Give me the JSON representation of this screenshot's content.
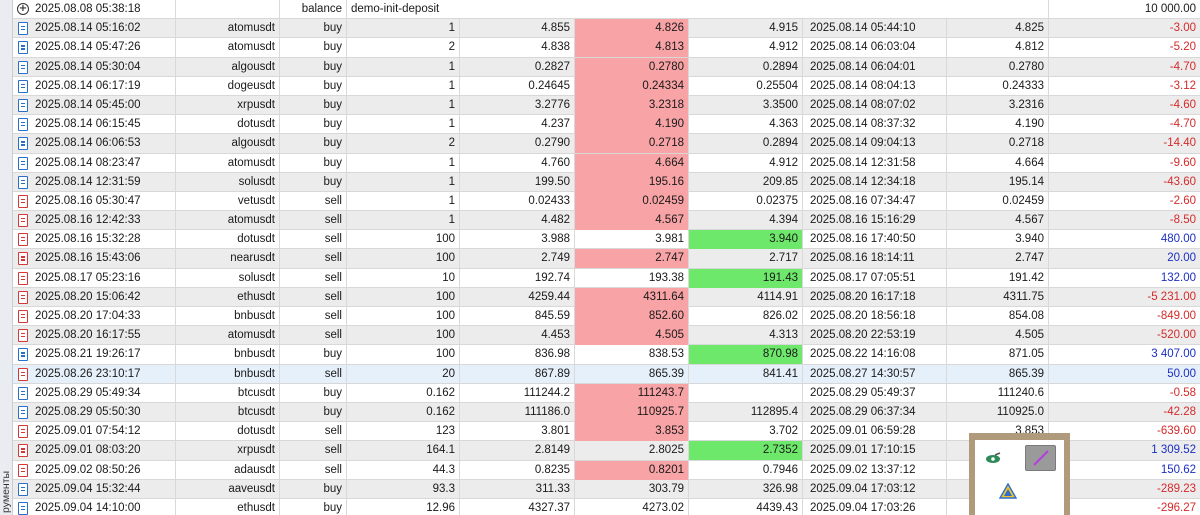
{
  "sidebar": {
    "label": "рументы"
  },
  "colors": {
    "row_alt": "#ececec",
    "row_plain": "#ffffff",
    "row_selected": "#e6f0fa",
    "loss_highlight": "#f8a3a6",
    "profit_highlight": "#6ee86a",
    "negative_text": "#d42a2a",
    "positive_text": "#1b2fc2",
    "buy_icon": "#2a6fc9",
    "sell_icon": "#d43838"
  },
  "balance_row": {
    "icon": "plus-circle-icon",
    "time": "2025.08.08 05:38:18",
    "type": "balance",
    "comment": "demo-init-deposit",
    "profit": "10 000.00"
  },
  "rows": [
    {
      "time": "2025.08.14 05:16:02",
      "symbol": "atomusdt",
      "type": "buy",
      "volume": "1",
      "open": "4.855",
      "sl": "4.826",
      "tp": "4.915",
      "close_time": "2025.08.14 05:44:10",
      "close_price": "4.825",
      "profit": "-3.00",
      "sl_hl": true,
      "tp_hl": false,
      "sign": "neg"
    },
    {
      "time": "2025.08.14 05:47:26",
      "symbol": "atomusdt",
      "type": "buy",
      "volume": "2",
      "open": "4.838",
      "sl": "4.813",
      "tp": "4.912",
      "close_time": "2025.08.14 06:03:04",
      "close_price": "4.812",
      "profit": "-5.20",
      "sl_hl": true,
      "tp_hl": false,
      "sign": "neg"
    },
    {
      "time": "2025.08.14 05:30:04",
      "symbol": "algousdt",
      "type": "buy",
      "volume": "1",
      "open": "0.2827",
      "sl": "0.2780",
      "tp": "0.2894",
      "close_time": "2025.08.14 06:04:01",
      "close_price": "0.2780",
      "profit": "-4.70",
      "sl_hl": true,
      "tp_hl": false,
      "sign": "neg"
    },
    {
      "time": "2025.08.14 06:17:19",
      "symbol": "dogeusdt",
      "type": "buy",
      "volume": "1",
      "open": "0.24645",
      "sl": "0.24334",
      "tp": "0.25504",
      "close_time": "2025.08.14 08:04:13",
      "close_price": "0.24333",
      "profit": "-3.12",
      "sl_hl": true,
      "tp_hl": false,
      "sign": "neg"
    },
    {
      "time": "2025.08.14 05:45:00",
      "symbol": "xrpusdt",
      "type": "buy",
      "volume": "1",
      "open": "3.2776",
      "sl": "3.2318",
      "tp": "3.3500",
      "close_time": "2025.08.14 08:07:02",
      "close_price": "3.2316",
      "profit": "-4.60",
      "sl_hl": true,
      "tp_hl": false,
      "sign": "neg"
    },
    {
      "time": "2025.08.14 06:15:45",
      "symbol": "dotusdt",
      "type": "buy",
      "volume": "1",
      "open": "4.237",
      "sl": "4.190",
      "tp": "4.363",
      "close_time": "2025.08.14 08:37:32",
      "close_price": "4.190",
      "profit": "-4.70",
      "sl_hl": true,
      "tp_hl": false,
      "sign": "neg"
    },
    {
      "time": "2025.08.14 06:06:53",
      "symbol": "algousdt",
      "type": "buy",
      "volume": "2",
      "open": "0.2790",
      "sl": "0.2718",
      "tp": "0.2894",
      "close_time": "2025.08.14 09:04:13",
      "close_price": "0.2718",
      "profit": "-14.40",
      "sl_hl": true,
      "tp_hl": false,
      "sign": "neg"
    },
    {
      "time": "2025.08.14 08:23:47",
      "symbol": "atomusdt",
      "type": "buy",
      "volume": "1",
      "open": "4.760",
      "sl": "4.664",
      "tp": "4.912",
      "close_time": "2025.08.14 12:31:58",
      "close_price": "4.664",
      "profit": "-9.60",
      "sl_hl": true,
      "tp_hl": false,
      "sign": "neg"
    },
    {
      "time": "2025.08.14 12:31:59",
      "symbol": "solusdt",
      "type": "buy",
      "volume": "1",
      "open": "199.50",
      "sl": "195.16",
      "tp": "209.85",
      "close_time": "2025.08.14 12:34:18",
      "close_price": "195.14",
      "profit": "-43.60",
      "sl_hl": true,
      "tp_hl": false,
      "sign": "neg"
    },
    {
      "time": "2025.08.16 05:30:47",
      "symbol": "vetusdt",
      "type": "sell",
      "volume": "1",
      "open": "0.02433",
      "sl": "0.02459",
      "tp": "0.02375",
      "close_time": "2025.08.16 07:34:47",
      "close_price": "0.02459",
      "profit": "-2.60",
      "sl_hl": true,
      "tp_hl": false,
      "sign": "neg"
    },
    {
      "time": "2025.08.16 12:42:33",
      "symbol": "atomusdt",
      "type": "sell",
      "volume": "1",
      "open": "4.482",
      "sl": "4.567",
      "tp": "4.394",
      "close_time": "2025.08.16 15:16:29",
      "close_price": "4.567",
      "profit": "-8.50",
      "sl_hl": true,
      "tp_hl": false,
      "sign": "neg"
    },
    {
      "time": "2025.08.16 15:32:28",
      "symbol": "dotusdt",
      "type": "sell",
      "volume": "100",
      "open": "3.988",
      "sl": "3.981",
      "tp": "3.940",
      "close_time": "2025.08.16 17:40:50",
      "close_price": "3.940",
      "profit": "480.00",
      "sl_hl": false,
      "tp_hl": true,
      "sign": "pos"
    },
    {
      "time": "2025.08.16 15:43:06",
      "symbol": "nearusdt",
      "type": "sell",
      "volume": "100",
      "open": "2.749",
      "sl": "2.747",
      "tp": "2.717",
      "close_time": "2025.08.16 18:14:11",
      "close_price": "2.747",
      "profit": "20.00",
      "sl_hl": true,
      "tp_hl": false,
      "sign": "pos"
    },
    {
      "time": "2025.08.17 05:23:16",
      "symbol": "solusdt",
      "type": "sell",
      "volume": "10",
      "open": "192.74",
      "sl": "193.38",
      "tp": "191.43",
      "close_time": "2025.08.17 07:05:51",
      "close_price": "191.42",
      "profit": "132.00",
      "sl_hl": false,
      "tp_hl": true,
      "sign": "pos"
    },
    {
      "time": "2025.08.20 15:06:42",
      "symbol": "ethusdt",
      "type": "sell",
      "volume": "100",
      "open": "4259.44",
      "sl": "4311.64",
      "tp": "4114.91",
      "close_time": "2025.08.20 16:17:18",
      "close_price": "4311.75",
      "profit": "-5 231.00",
      "sl_hl": true,
      "tp_hl": false,
      "sign": "neg"
    },
    {
      "time": "2025.08.20 17:04:33",
      "symbol": "bnbusdt",
      "type": "sell",
      "volume": "100",
      "open": "845.59",
      "sl": "852.60",
      "tp": "826.02",
      "close_time": "2025.08.20 18:56:18",
      "close_price": "854.08",
      "profit": "-849.00",
      "sl_hl": true,
      "tp_hl": false,
      "sign": "neg"
    },
    {
      "time": "2025.08.20 16:17:55",
      "symbol": "atomusdt",
      "type": "sell",
      "volume": "100",
      "open": "4.453",
      "sl": "4.505",
      "tp": "4.313",
      "close_time": "2025.08.20 22:53:19",
      "close_price": "4.505",
      "profit": "-520.00",
      "sl_hl": true,
      "tp_hl": false,
      "sign": "neg"
    },
    {
      "time": "2025.08.21 19:26:17",
      "symbol": "bnbusdt",
      "type": "buy",
      "volume": "100",
      "open": "836.98",
      "sl": "838.53",
      "tp": "870.98",
      "close_time": "2025.08.22 14:16:08",
      "close_price": "871.05",
      "profit": "3 407.00",
      "sl_hl": false,
      "tp_hl": true,
      "sign": "pos"
    },
    {
      "time": "2025.08.26 23:10:17",
      "symbol": "bnbusdt",
      "type": "sell",
      "volume": "20",
      "open": "867.89",
      "sl": "865.39",
      "tp": "841.41",
      "close_time": "2025.08.27 14:30:57",
      "close_price": "865.39",
      "profit": "50.00",
      "sl_hl": false,
      "tp_hl": false,
      "sign": "pos",
      "selected": true
    },
    {
      "time": "2025.08.29 05:49:34",
      "symbol": "btcusdt",
      "type": "buy",
      "volume": "0.162",
      "open": "111244.2",
      "sl": "111243.7",
      "tp": "",
      "close_time": "2025.08.29 05:49:37",
      "close_price": "111240.6",
      "profit": "-0.58",
      "sl_hl": true,
      "tp_hl": false,
      "sign": "neg"
    },
    {
      "time": "2025.08.29 05:50:30",
      "symbol": "btcusdt",
      "type": "buy",
      "volume": "0.162",
      "open": "111186.0",
      "sl": "110925.7",
      "tp": "112895.4",
      "close_time": "2025.08.29 06:37:34",
      "close_price": "110925.0",
      "profit": "-42.28",
      "sl_hl": true,
      "tp_hl": false,
      "sign": "neg"
    },
    {
      "time": "2025.09.01 07:54:12",
      "symbol": "dotusdt",
      "type": "sell",
      "volume": "123",
      "open": "3.801",
      "sl": "3.853",
      "tp": "3.702",
      "close_time": "2025.09.01 06:59:28",
      "close_price": "3.853",
      "profit": "-639.60",
      "sl_hl": true,
      "tp_hl": false,
      "sign": "neg"
    },
    {
      "time": "2025.09.01 08:03:20",
      "symbol": "xrpusdt",
      "type": "sell",
      "volume": "164.1",
      "open": "2.8149",
      "sl": "2.8025",
      "tp": "2.7352",
      "close_time": "2025.09.01 17:10:15",
      "close_price": "",
      "profit": "1 309.52",
      "sl_hl": false,
      "tp_hl": true,
      "sign": "pos"
    },
    {
      "time": "2025.09.02 08:50:26",
      "symbol": "adausdt",
      "type": "sell",
      "volume": "44.3",
      "open": "0.8235",
      "sl": "0.8201",
      "tp": "0.7946",
      "close_time": "2025.09.02 13:37:12",
      "close_price": "",
      "profit": "150.62",
      "sl_hl": true,
      "tp_hl": false,
      "sign": "pos"
    },
    {
      "time": "2025.09.04 15:32:44",
      "symbol": "aaveusdt",
      "type": "buy",
      "volume": "93.3",
      "open": "311.33",
      "sl": "303.79",
      "tp": "326.98",
      "close_time": "2025.09.04 17:03:12",
      "close_price": "",
      "profit": "-289.23",
      "sl_hl": false,
      "tp_hl": false,
      "sign": "neg"
    },
    {
      "time": "2025.09.04 14:10:00",
      "symbol": "ethusdt",
      "type": "buy",
      "volume": "12.96",
      "open": "4327.37",
      "sl": "4273.02",
      "tp": "4439.43",
      "close_time": "2025.09.04 17:03:26",
      "close_price": "",
      "profit": "-296.27",
      "sl_hl": false,
      "tp_hl": false,
      "sign": "neg"
    }
  ],
  "popup": {
    "tools": [
      {
        "icon": "brush-eye-icon"
      },
      {
        "icon": "diagonal-line-icon",
        "active": true
      },
      {
        "icon": "triangle-shape-icon"
      }
    ]
  }
}
